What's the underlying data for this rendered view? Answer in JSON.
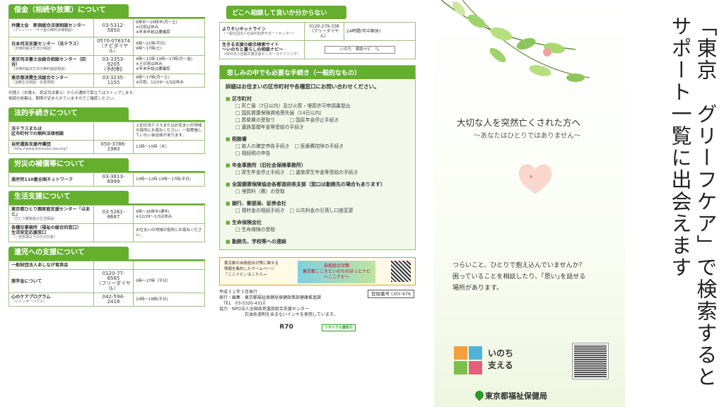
{
  "col1": {
    "s1": {
      "title": "借金（相続や放棄）について",
      "rows": [
        {
          "org": "弁護士会　新宿総合法律相談センター",
          "sub": "（クレジット・サラ金の無料法律相談）",
          "tel": "03-5312-5850",
          "hours": "9時半〜16時半(月〜土)\n※日祝は休み\n※年末年始は要確認"
        },
        {
          "org": "日本司法支援センター（法テラス）",
          "sub": "（法律的解決方法の相談）",
          "tel": "0570-078374\n（ナビダイヤル）",
          "hours": "9時〜21時(平日)\n9時〜17時(土)"
        },
        {
          "org": "東京司法書士会総合相談センター（四谷）",
          "sub": "（法律的解決方法の無料面談相談）",
          "tel": "03-3353-9205\n（予約制）",
          "hours": "9時〜12時,13時〜17時(月〜金)\n※土日祝は休み\n※年末年始は要確認"
        },
        {
          "org": "東京都消費生活総合センター",
          "sub": "（消費生活相談・多重債務）",
          "tel": "03-3235-1155",
          "hours": "9時〜17時(月〜土)\n※日祝、12/29〜1/3は休み"
        }
      ],
      "note": "代理人（弁護士、認定司法書士）からの通知で取立てはストップします。\n相続の放棄は、期限が定められていますのでご確認ください。"
    },
    "s2": {
      "title": "法的手続きについて",
      "rows": [
        {
          "org": "法テラスまたは\n区市町村での無料法律相談",
          "sub": "",
          "tel": "",
          "hours": "上記の法テラスまたはお住まいの地域の役所にお尋ねください。一部実施していない自治体があります。"
        },
        {
          "org": "自死遺族支援弁護団",
          "sub": "（http://www.jishiizoku-law.org/）",
          "tel": "050-3786-1980",
          "hours": "12時〜15時（木）"
        }
      ]
    },
    "s3": {
      "title": "労災の補償等について",
      "rows": [
        {
          "org": "過労死110番全国ネットワーク",
          "sub": "",
          "tel": "03-3813-6999",
          "hours": "10時〜12時,13時〜17時(平日)"
        }
      ]
    },
    "s4": {
      "title": "生活支援について",
      "rows": [
        {
          "org": "東京都ひとり親家庭支援センター「はあと」",
          "sub": "（ひとり親家庭の生活相談）",
          "tel": "03-5261-8687",
          "hours": "9時〜16時半(通年)\n※12/29〜1/3は休み"
        },
        {
          "org": "各種社事務所（福祉の総合的窓口）\n生活安定応援窓口",
          "sub": "（一定所得以下の方が対象）",
          "tel": "",
          "hours": "お住まいの地域の役所にお尋ねください。"
        }
      ]
    },
    "s5": {
      "title": "遺児への支援について",
      "rows": [
        {
          "org": "一般財団法人あしなが育英会",
          "sub": "",
          "tel": "",
          "hours": ""
        },
        {
          "org": "奨学金について",
          "sub": "",
          "tel": "0120-77-8565\n（フリーダイヤル）",
          "hours": "9時〜17時（平日）"
        },
        {
          "org": "心のケアプログラム",
          "sub": "（レインボーハウス）",
          "tel": "042-594-2418",
          "hours": "10時〜18時(平日)"
        }
      ]
    }
  },
  "col2": {
    "title": "どこへ相談して良いか分からない",
    "r1": {
      "org": "よりそいホットライン",
      "sub": "（一般社団法人社会的包摂サポートセンター）",
      "tel": "0120-279-338\n（フリーダイヤル）",
      "hours": "24時間(年中無休)"
    },
    "r2": {
      "org": "生きる支援の総合検索サイト\n〜いのちと暮らしの相談ナビ〜",
      "sub": "（NPO法人自殺対策支援センターライフリンク）",
      "kw": "いのち　相談ナビ　🔍"
    },
    "box_title": "悲しみの中でも必要な手続き（一般的なもの）",
    "box_intro": "詳細はお住まいの区市町村や各種窓口にお問い合わせください。",
    "cats": [
      {
        "name": "区市町村",
        "items": [
          "□ 死亡届（7日以内）及び火葬・埋葬許可申請書提出",
          "□ 国民健康保険資格喪失届（14日以内）",
          "□ 葬祭費の受取り　　　□ 国民年金停止手続き",
          "□ 遺族基礎年金等受給の手続き"
        ]
      },
      {
        "name": "税務署",
        "items": [
          "□ 故人の確定申告手続き　□ 医療費控除の手続き",
          "□ 相続税の申告"
        ]
      },
      {
        "name": "年金事務所（旧社会保険事務所）",
        "items": [
          "□ 厚生年金停止手続き　□ 遺族厚生年金等受給の手続き"
        ]
      },
      {
        "name": "全国健康保険協会各都道府県支部（窓口は勤務先の場合もあります）",
        "items": [
          "□ 埋葬料（費）の受取"
        ]
      },
      {
        "name": "銀行、郵便局、証券会社",
        "items": [
          "□ 預貯金の相続手続き　□ 公共料金の引落し口座変更"
        ]
      },
      {
        "name": "生命保険会社",
        "items": [
          "□ 生命保険の受取"
        ]
      },
      {
        "name": "勤務先、学校等への連絡",
        "items": []
      }
    ],
    "banner_text": "東京都の自殺総合対策に関する\n情報を集約したホームページ\n「ここナビ」はこちら→",
    "banner_img": "自殺総合対策\n東京都こころといのちのほっとナビ\n〜ここナビ〜",
    "pub_lines": [
      "平成３１年３月発行",
      "発行・編集　東京都福祉保健局保健政策部健康推進課",
      "　TEL　03-5320-4310",
      "協力　NPO法人全国自死遺族総合支援センター",
      "　　　　　　石油系溶剤を含まないインキを使用しています。"
    ],
    "reg": "登録番号 (30) 476",
    "foot": "R70",
    "foot_badge": "リサイクル適性Ⓐ"
  },
  "col3": {
    "lead": "大切な人を突然亡くされた方へ",
    "sub": "〜あなたはひとりではありません〜",
    "para": "つらいこと、ひとりで抱え込んでいませんか？\n困っていることを相談したり、｢思い｣を話せる\n場所があります。",
    "logo_text": "いのち\n支える",
    "bureau": "東京都福祉保健局"
  },
  "title": "「東京　グリーフケア」で検索するとサポート一覧に出会えます"
}
